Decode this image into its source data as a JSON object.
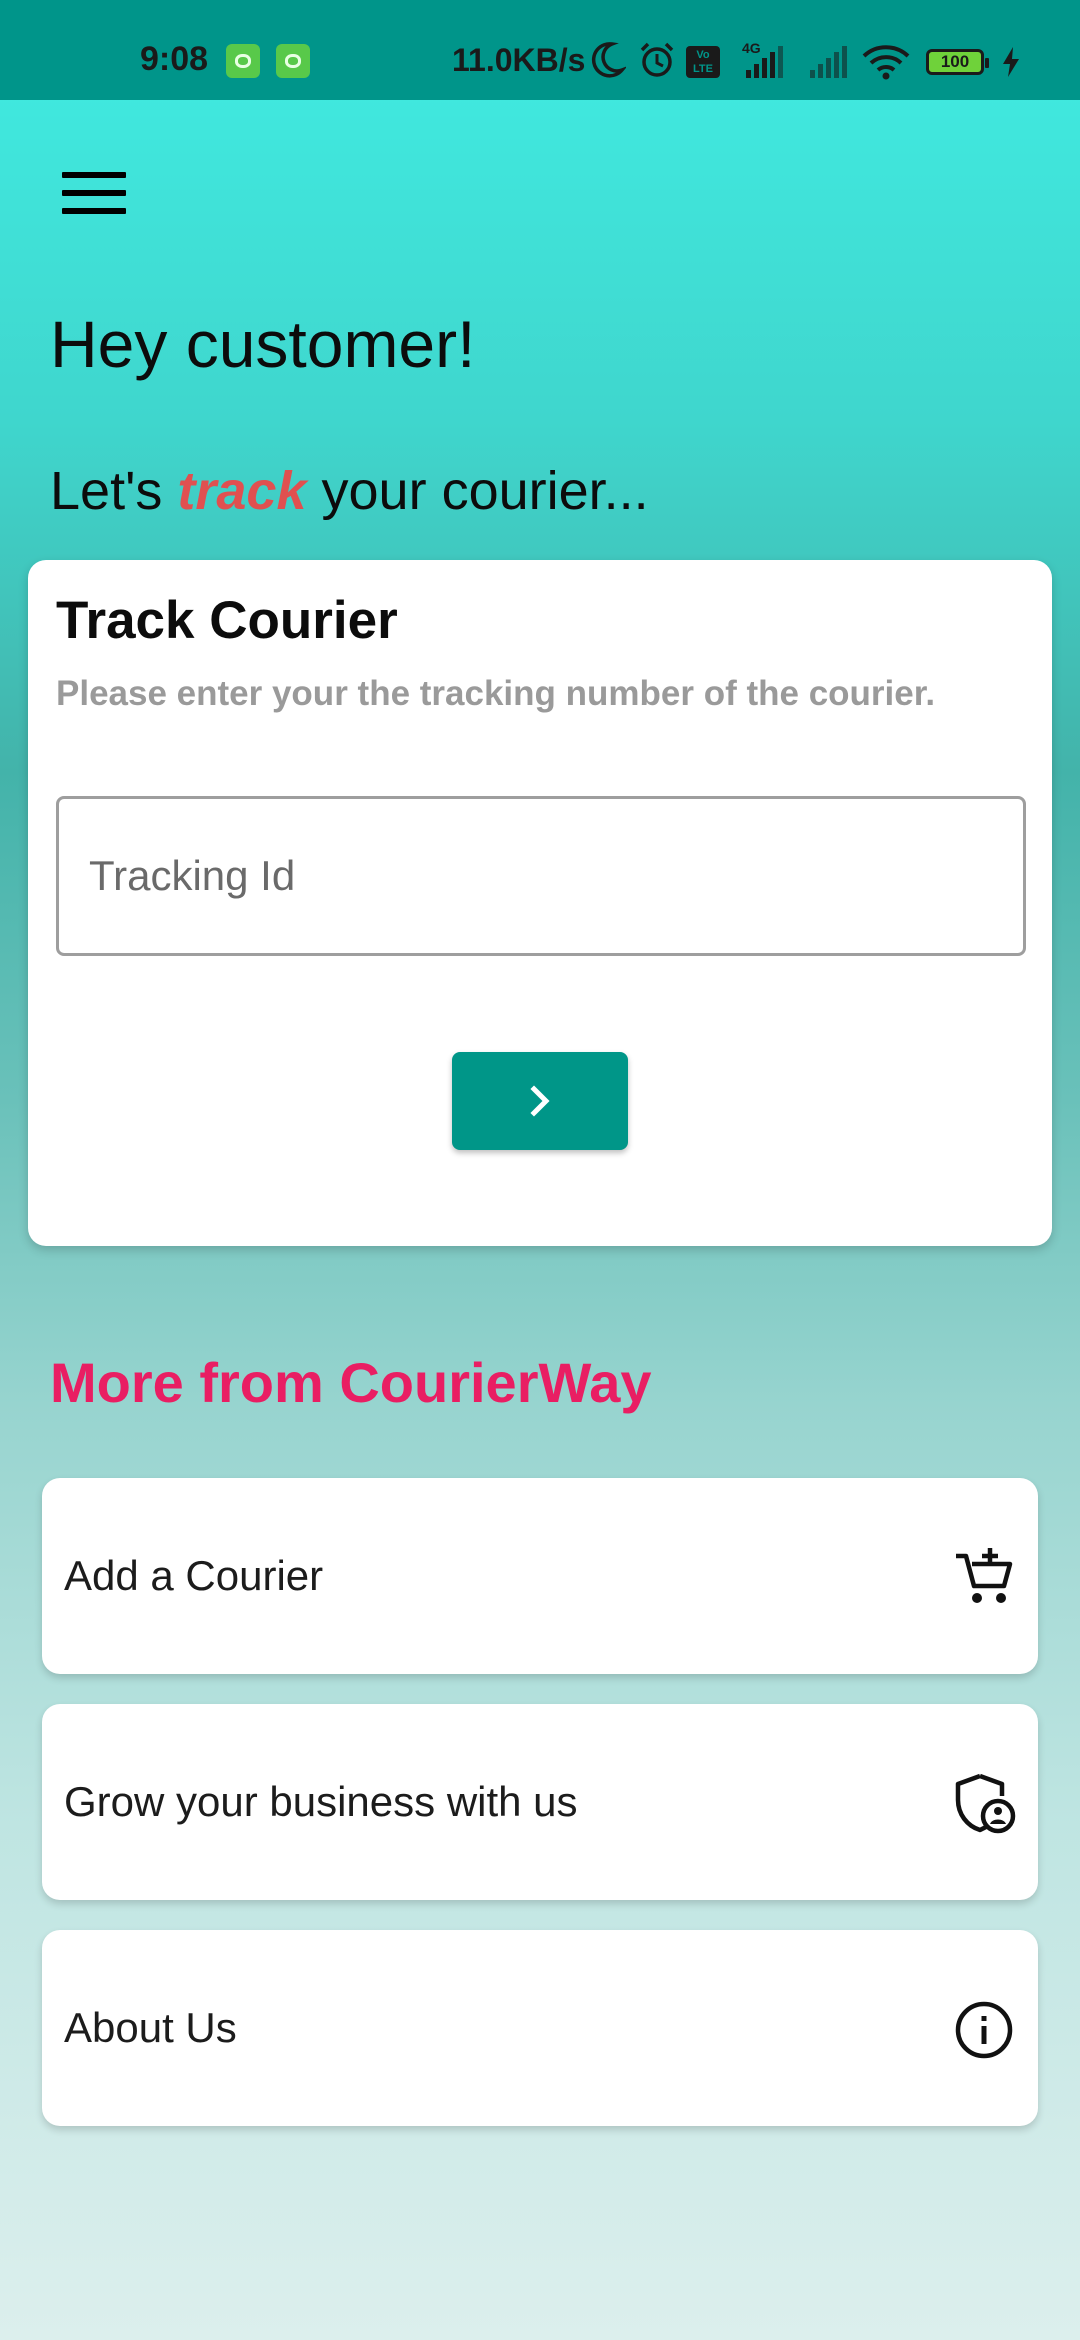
{
  "status_bar": {
    "time": "9:08",
    "network_speed": "11.0KB/s",
    "network_type": "4G",
    "volte": "Vo LTE",
    "battery": "100"
  },
  "header": {
    "greeting": "Hey customer!",
    "tagline_prefix": "Let's",
    "tagline_emphasis": "track",
    "tagline_suffix": "your courier..."
  },
  "track_card": {
    "title": "Track Courier",
    "subtitle": "Please enter your the tracking number of the courier.",
    "input_placeholder": "Tracking Id",
    "input_value": "",
    "submit_icon": "chevron-right-icon"
  },
  "more_section": {
    "heading": "More from CourierWay",
    "items": [
      {
        "label": "Add a Courier",
        "icon": "add-shopping-cart-icon"
      },
      {
        "label": "Grow your business with us",
        "icon": "admin-shield-icon"
      },
      {
        "label": "About Us",
        "icon": "info-icon"
      }
    ]
  },
  "colors": {
    "status_bar": "#00958a",
    "primary_button": "#009688",
    "accent_pink": "#e91e63",
    "track_emphasis": "#e05050",
    "subtitle_gray": "#9a9a9a"
  }
}
